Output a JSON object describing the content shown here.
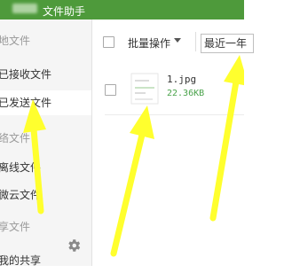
{
  "titlebar": {
    "title": "文件助手"
  },
  "sidebar": {
    "items": [
      {
        "label": "地文件",
        "kind": "header"
      },
      {
        "label": "已接收文件",
        "kind": "item"
      },
      {
        "label": "已发送文件",
        "kind": "item",
        "active": true
      },
      {
        "label": "络文件",
        "kind": "header"
      },
      {
        "label": "离线文件",
        "kind": "item"
      },
      {
        "label": "微云文件",
        "kind": "item"
      },
      {
        "label": "享文件",
        "kind": "header"
      },
      {
        "label": "我的共享",
        "kind": "item"
      }
    ],
    "settings_icon": "gear-icon"
  },
  "toolbar": {
    "batch_label": "批量操作",
    "date_filter": "最近一年"
  },
  "files": [
    {
      "name": "1.jpg",
      "size": "22.36KB"
    }
  ],
  "colors": {
    "titlebar_bg": "#4e9a3b",
    "size_text": "#49a24a",
    "arrow": "#ffff2e"
  }
}
